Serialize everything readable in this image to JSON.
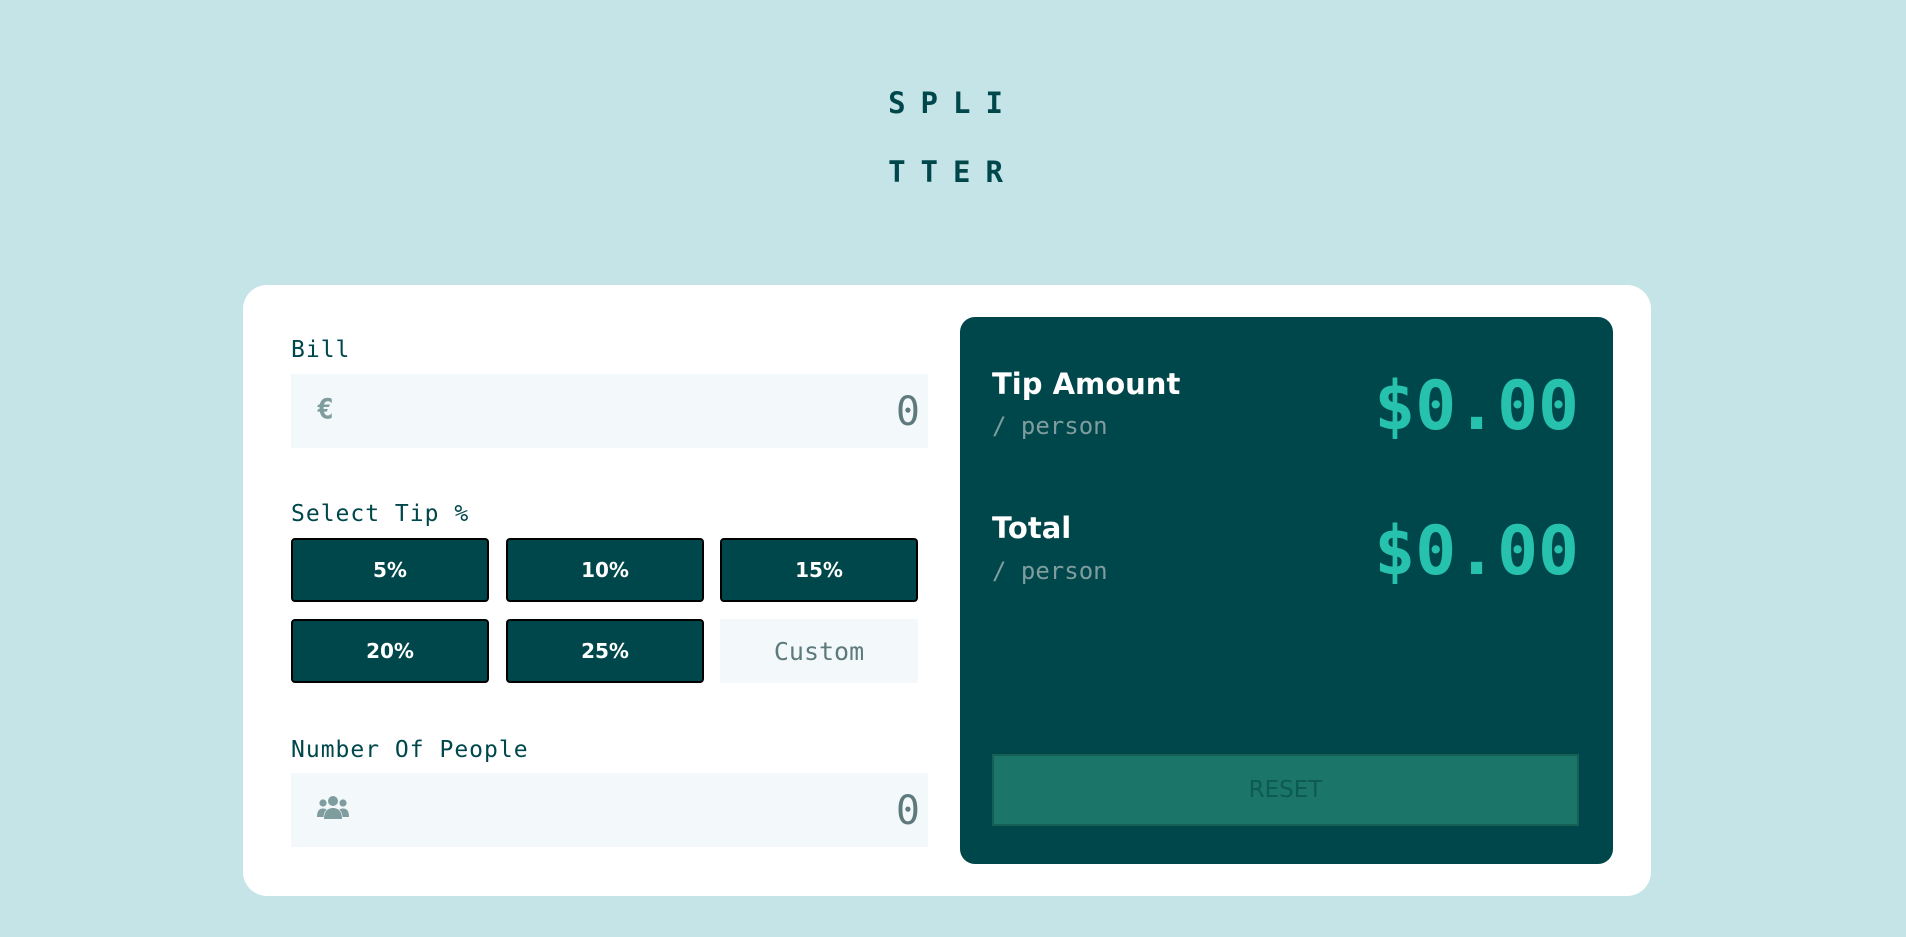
{
  "app": {
    "logo_line1": "SPLI",
    "logo_line2": "TTER"
  },
  "bill": {
    "label": "Bill",
    "currency_icon": "euro-icon",
    "currency_symbol": "€",
    "value": "0"
  },
  "tip": {
    "label": "Select Tip %",
    "options": [
      "5%",
      "10%",
      "15%",
      "20%",
      "25%"
    ],
    "custom_placeholder": "Custom"
  },
  "people": {
    "label": "Number Of People",
    "icon": "people-icon",
    "value": "0"
  },
  "results": {
    "tip_amount_label": "Tip Amount",
    "tip_amount_sub": "/ person",
    "tip_amount_value": "$0.00",
    "total_label": "Total",
    "total_sub": "/ person",
    "total_value": "$0.00",
    "reset_label": "RESET"
  },
  "colors": {
    "background": "#c5e4e7",
    "card": "#ffffff",
    "dark_teal": "#00474b",
    "accent": "#26c2ae",
    "input_bg": "#f3f9fa",
    "reset_bg": "#1b7569"
  }
}
